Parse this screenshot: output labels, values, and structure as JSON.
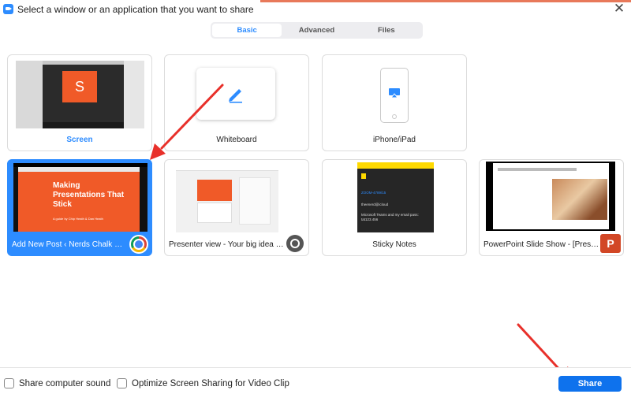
{
  "window": {
    "title": "Select a window or an application that you want to share",
    "close_glyph": "✕",
    "brand_color": "#2d8cff"
  },
  "tabs": [
    {
      "label": "Basic",
      "active": true
    },
    {
      "label": "Advanced",
      "active": false
    },
    {
      "label": "Files",
      "active": false
    }
  ],
  "tiles": [
    {
      "label": "Screen",
      "thumb_text": "S"
    },
    {
      "label": "Whiteboard"
    },
    {
      "label": "iPhone/iPad"
    },
    {
      "label": "Add New Post ‹ Nerds Chalk — ...",
      "selected": true,
      "app_icon": "chrome-icon",
      "slide_title": "Making Presentations That Stick",
      "slide_sub": "A guide by Chip Heath & Dan Heath"
    },
    {
      "label": "Presenter view - Your big idea - G...",
      "app_icon": "globe-icon"
    },
    {
      "label": "Sticky Notes",
      "note_lines": [
        "ZOOM-4789/15",
        "theenerd@icloud",
        "Microsoft Teams and my email pass: tat123.456"
      ]
    },
    {
      "label": "PowerPoint Slide Show - [Present...",
      "app_icon": "powerpoint-icon",
      "app_icon_text": "P"
    }
  ],
  "footer": {
    "share_sound_label": "Share computer sound",
    "optimize_label": "Optimize Screen Sharing for Video Clip",
    "share_button": "Share"
  },
  "colors": {
    "accent": "#2d8cff",
    "share_button": "#0e72ed",
    "annotation_arrow": "#e8302a"
  }
}
